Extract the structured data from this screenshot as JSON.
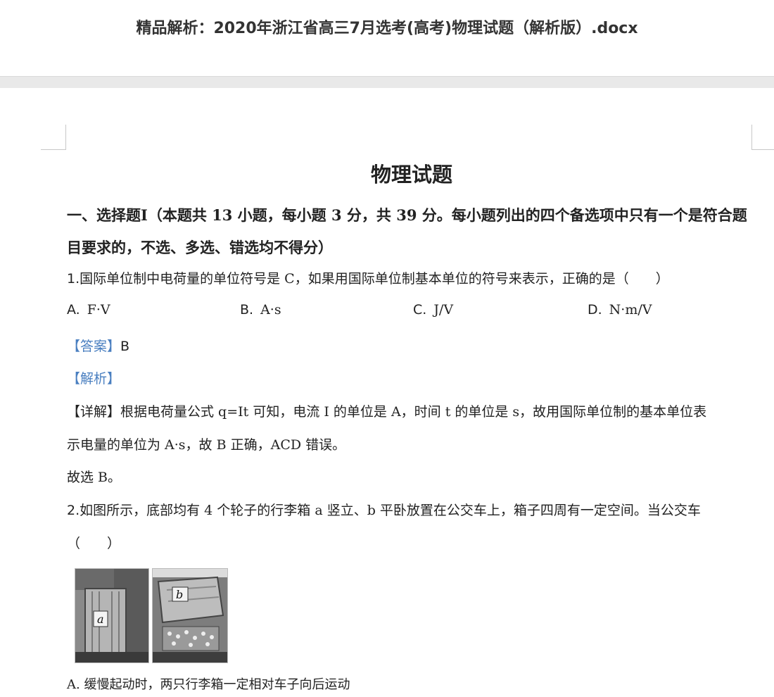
{
  "window": {
    "title": "精品解析：2020年浙江省高三7月选考(高考)物理试题（解析版）.docx"
  },
  "doc": {
    "page_title": "物理试题",
    "section": "一、选择题Ⅰ（本题共 13 小题，每小题 3 分，共 39 分。每小题列出的四个备选项中只有一个是符合题目要求的，不选、多选、错选均不得分）",
    "q1": {
      "num": "1.",
      "text": "国际单位制中电荷量的单位符号是 C，如果用国际单位制基本单位的符号来表示，正确的是（　　）",
      "options": [
        {
          "letter": "A.",
          "text": "F·V"
        },
        {
          "letter": "B.",
          "text": "A·s"
        },
        {
          "letter": "C.",
          "text": "J/V"
        },
        {
          "letter": "D.",
          "text": "N·m/V"
        }
      ],
      "answer_tag": "【答案】",
      "answer": "B",
      "analysis_tag": "【解析】",
      "detail_tag": "【详解】",
      "detail_line1": "根据电荷量公式 q=It 可知，电流 I 的单位是 A，时间 t 的单位是 s，故用国际单位制的基本单位表",
      "detail_line2": "示电量的单位为 A·s，故 B 正确，ACD 错误。",
      "conclusion": "故选 B。"
    },
    "q2": {
      "num": "2.",
      "text": "如图所示，底部均有 4 个轮子的行李箱 a 竖立、b 平卧放置在公交车上，箱子四周有一定空间。当公交车",
      "paren": "（　　）",
      "label_a": "a",
      "label_b": "b",
      "optA": "A.  缓慢起动时，两只行李箱一定相对车子向后运动"
    }
  }
}
